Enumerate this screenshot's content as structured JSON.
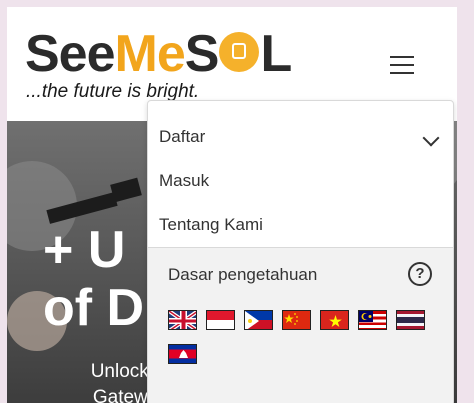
{
  "brand": {
    "logo_see": "See",
    "logo_me": "Me",
    "logo_s": "S",
    "logo_l": "L",
    "tagline": "...the future is bright.",
    "accent_color": "#f2a51c"
  },
  "header": {
    "menu_icon": "hamburger-icon"
  },
  "hero": {
    "title_line1": "+ U",
    "title_line2": "of D",
    "subtitle": "Unlock Your Career Potential: Your Gateway to Success Begins Here!"
  },
  "menu": {
    "items": [
      {
        "label": "Daftar",
        "icon": "chevron-down-icon"
      },
      {
        "label": "Masuk"
      },
      {
        "label": "Tentang Kami"
      }
    ],
    "knowledge_base": {
      "label": "Dasar pengetahuan",
      "icon": "help-circle-icon",
      "help_glyph": "?"
    },
    "languages": [
      {
        "flag": "united-kingdom"
      },
      {
        "flag": "indonesia"
      },
      {
        "flag": "philippines"
      },
      {
        "flag": "china"
      },
      {
        "flag": "vietnam"
      },
      {
        "flag": "malaysia"
      },
      {
        "flag": "thailand"
      },
      {
        "flag": "cambodia"
      }
    ]
  }
}
